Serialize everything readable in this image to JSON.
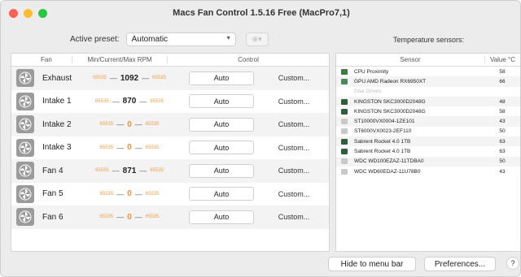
{
  "window": {
    "title": "Macs Fan Control 1.5.16 Free (MacPro7,1)"
  },
  "preset": {
    "label": "Active preset:",
    "value": "Automatic",
    "add_label": "⊕▾"
  },
  "fans": {
    "headers": {
      "fan": "Fan",
      "rpm": "Min/Current/Max RPM",
      "control": "Control"
    },
    "rows": [
      {
        "name": "Exhaust",
        "min": "65535",
        "current": "1092",
        "max": "65535",
        "auto": "Auto",
        "custom": "Custom..."
      },
      {
        "name": "Intake 1",
        "min": "65535",
        "current": "870",
        "max": "65535",
        "auto": "Auto",
        "custom": "Custom..."
      },
      {
        "name": "Intake 2",
        "min": "65535",
        "current": "0",
        "max": "65535",
        "auto": "Auto",
        "custom": "Custom..."
      },
      {
        "name": "Intake 3",
        "min": "65535",
        "current": "0",
        "max": "65535",
        "auto": "Auto",
        "custom": "Custom..."
      },
      {
        "name": "Fan 4",
        "min": "65535",
        "current": "871",
        "max": "65535",
        "auto": "Auto",
        "custom": "Custom..."
      },
      {
        "name": "Fan 5",
        "min": "65535",
        "current": "0",
        "max": "65535",
        "auto": "Auto",
        "custom": "Custom..."
      },
      {
        "name": "Fan 6",
        "min": "65535",
        "current": "0",
        "max": "65535",
        "auto": "Auto",
        "custom": "Custom..."
      }
    ]
  },
  "sensors": {
    "heading": "Temperature sensors:",
    "headers": {
      "sensor": "Sensor",
      "value": "Value °C"
    },
    "rows": [
      {
        "name": "CPU Proximity",
        "value": "58",
        "icon": "chip",
        "disabled": false
      },
      {
        "name": "GPU AMD Radeon RX6950XT",
        "value": "66",
        "icon": "gpu",
        "disabled": false
      },
      {
        "name": "Disk Drives:",
        "value": "",
        "icon": "",
        "disabled": true
      },
      {
        "name": "KINGSTON SKC3000D2048G",
        "value": "48",
        "icon": "ssd",
        "disabled": false
      },
      {
        "name": "KINGSTON SKC3000D2048G",
        "value": "58",
        "icon": "ssd",
        "disabled": false
      },
      {
        "name": "ST10000VX0004-1ZE101",
        "value": "43",
        "icon": "hdd",
        "disabled": false
      },
      {
        "name": "ST6000VX0023-2EF110",
        "value": "50",
        "icon": "hdd",
        "disabled": false
      },
      {
        "name": "Sabrent Rocket 4.0 1TB",
        "value": "63",
        "icon": "ssd",
        "disabled": false
      },
      {
        "name": "Sabrent Rocket 4.0 1TB",
        "value": "63",
        "icon": "ssd",
        "disabled": false
      },
      {
        "name": "WDC WD100EZAZ-11TDBA0",
        "value": "50",
        "icon": "hdd",
        "disabled": false
      },
      {
        "name": "WDC WD60EDAZ-11U78B0",
        "value": "43",
        "icon": "hdd",
        "disabled": false
      }
    ]
  },
  "footer": {
    "hide_label": "Hide to menu bar",
    "prefs_label": "Preferences...",
    "help_label": "?"
  },
  "colors": {
    "rpm_limit": "#f0a04b",
    "rpm_zero": "#e8923a"
  }
}
